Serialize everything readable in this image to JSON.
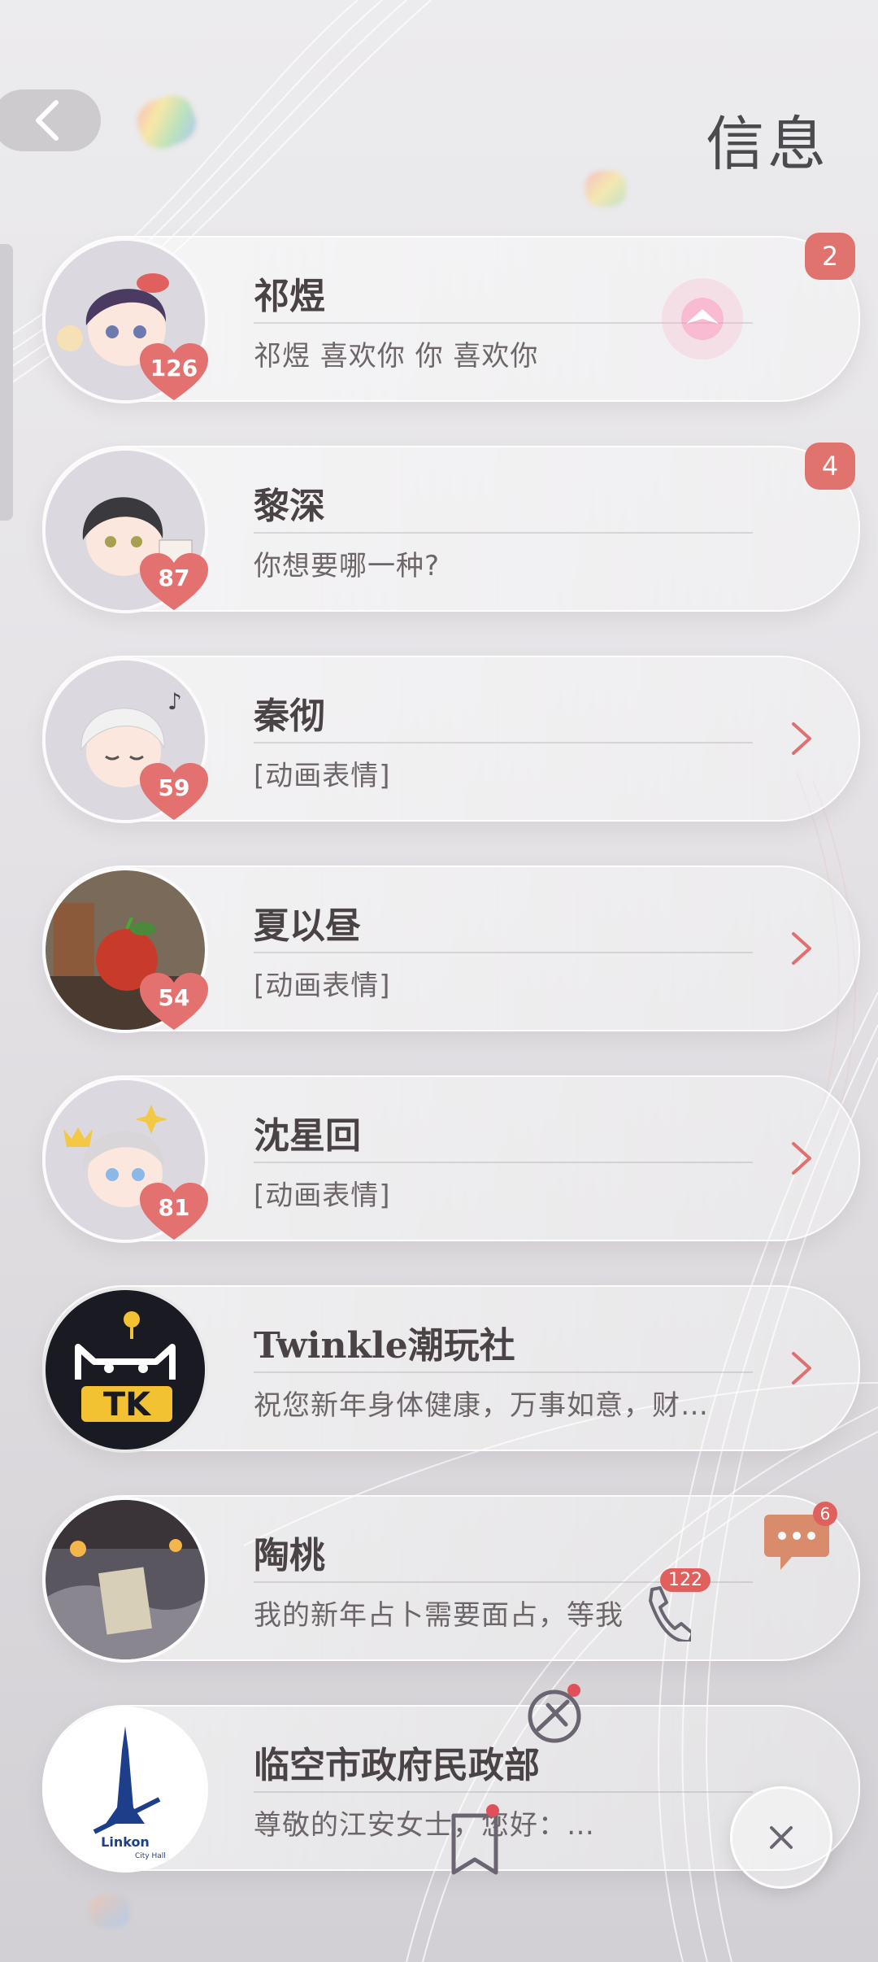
{
  "header": {
    "title": "信息"
  },
  "contacts": [
    {
      "name": "祁煜",
      "preview": "祁煜 喜欢你 你 喜欢你",
      "level": "126",
      "unread": "2"
    },
    {
      "name": "黎深",
      "preview": "你想要哪一种?",
      "level": "87",
      "unread": "4"
    },
    {
      "name": "秦彻",
      "preview": "[动画表情]",
      "level": "59"
    },
    {
      "name": "夏以昼",
      "preview": "[动画表情]",
      "level": "54"
    },
    {
      "name": "沈星回",
      "preview": "[动画表情]",
      "level": "81"
    },
    {
      "name": "Twinkle潮玩社",
      "preview": "祝您新年身体健康，万事如意，财…"
    },
    {
      "name": "陶桃",
      "preview": "我的新年占卜需要面占，等我"
    },
    {
      "name": "临空市政府民政部",
      "preview": "尊敬的江安女士，您好：…"
    }
  ],
  "logo_text": {
    "tk": "TK",
    "linkon": "Linkon",
    "city_hall": "City Hall"
  },
  "floating": {
    "chat_badge": "6",
    "phone_badge": "122"
  },
  "colors": {
    "accent": "#e0736e",
    "arrow": "#e07070",
    "badge": "#e0605d"
  },
  "icons": [
    "back-arrow-icon",
    "chevron-right-icon",
    "chat-bubble-icon",
    "phone-icon",
    "pin-icon",
    "bookmark-icon",
    "close-icon",
    "heart-icon"
  ]
}
